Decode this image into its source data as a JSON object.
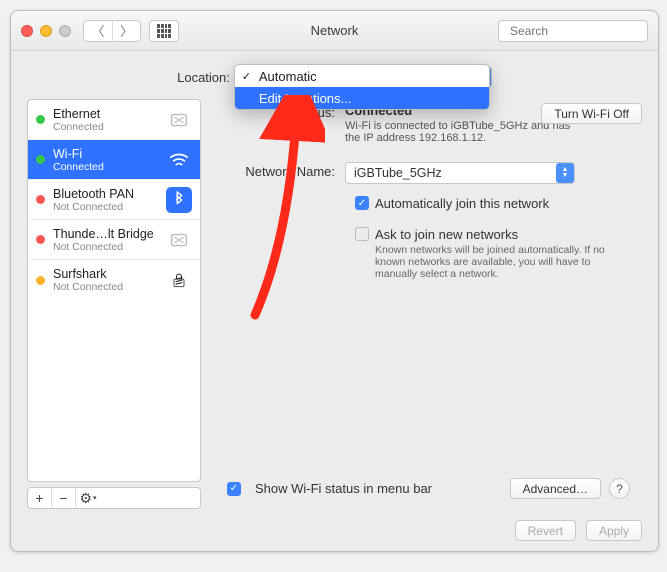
{
  "window": {
    "title": "Network"
  },
  "search": {
    "placeholder": "Search"
  },
  "location": {
    "label": "Location:",
    "options": [
      {
        "label": "Automatic",
        "checked": true,
        "selected": false
      },
      {
        "label": "Edit Locations...",
        "checked": false,
        "selected": true
      }
    ]
  },
  "sidebar": {
    "services": [
      {
        "name": "Ethernet",
        "status": "Connected",
        "dot": "green",
        "icon": "ethernet-icon"
      },
      {
        "name": "Wi-Fi",
        "status": "Connected",
        "dot": "green",
        "icon": "wifi-icon",
        "selected": true
      },
      {
        "name": "Bluetooth PAN",
        "status": "Not Connected",
        "dot": "red",
        "icon": "bluetooth-icon"
      },
      {
        "name": "Thunde…lt Bridge",
        "status": "Not Connected",
        "dot": "red",
        "icon": "thunderbolt-icon"
      },
      {
        "name": "Surfshark",
        "status": "Not Connected",
        "dot": "orange",
        "icon": "vpn-icon"
      }
    ],
    "tools": {
      "add": "+",
      "remove": "−",
      "gear": "⚙︎"
    }
  },
  "pane": {
    "status_label": "Status:",
    "status_value": "Connected",
    "status_desc": "Wi-Fi is connected to iGBTube_5GHz and has the IP address 192.168.1.12.",
    "wifi_toggle": "Turn Wi-Fi Off",
    "network_name_label": "Network Name:",
    "network_name_value": "iGBTube_5GHz",
    "auto_join": {
      "checked": true,
      "label": "Automatically join this network"
    },
    "ask_join": {
      "checked": false,
      "label": "Ask to join new networks",
      "note": "Known networks will be joined automatically. If no known networks are available, you will have to manually select a network."
    },
    "show_status": {
      "checked": true,
      "label": "Show Wi-Fi status in menu bar"
    },
    "advanced": "Advanced…",
    "help": "?"
  },
  "footer": {
    "revert": "Revert",
    "apply": "Apply"
  },
  "colors": {
    "accent": "#2f72ff",
    "arrow": "#ff2a1a"
  }
}
